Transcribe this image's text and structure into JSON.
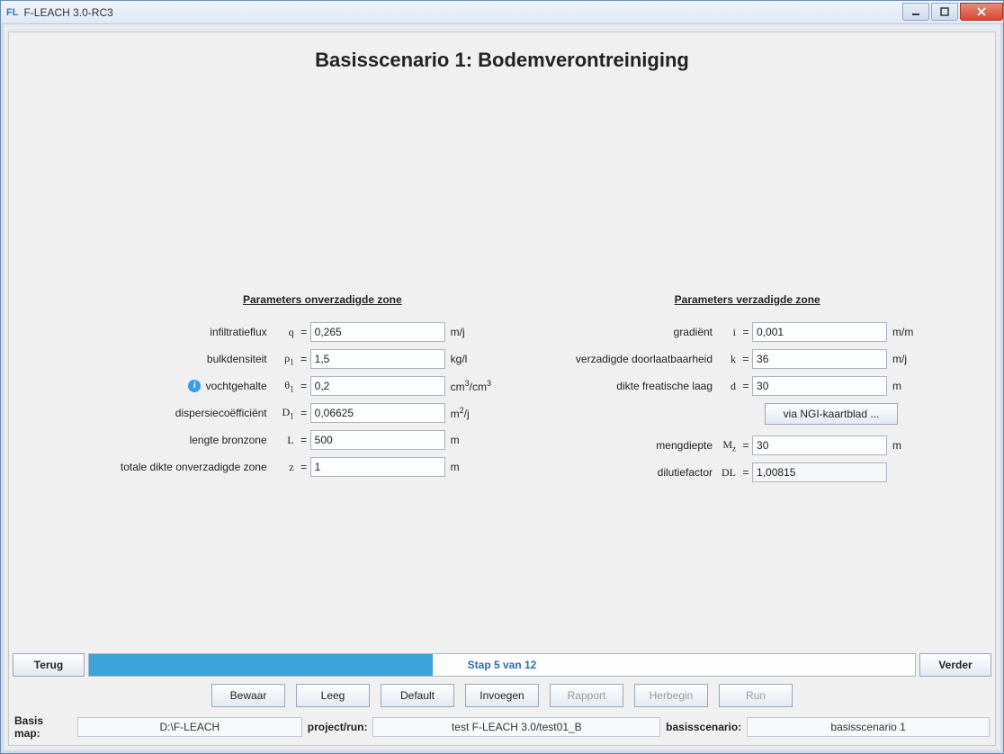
{
  "window": {
    "app_icon": "FL",
    "title": "F-LEACH 3.0-RC3"
  },
  "page_title": "Basisscenario 1: Bodemverontreiniging",
  "headers": {
    "left": "Parameters onverzadigde zone",
    "right": "Parameters verzadigde zone"
  },
  "left_params": {
    "infiltratieflux": {
      "label": "infiltratieflux",
      "sym": "q",
      "value": "0,265",
      "unit": "m/j"
    },
    "bulkdensiteit": {
      "label": "bulkdensiteit",
      "sym": "ρ",
      "sub": "1",
      "value": "1,5",
      "unit": "kg/l"
    },
    "vochtgehalte": {
      "label": "vochtgehalte",
      "sym": "θ",
      "sub": "1",
      "value": "0,2",
      "unit_html": "cm³/cm³"
    },
    "dispersie": {
      "label": "dispersiecoëfficiënt",
      "sym": "D",
      "sub": "1",
      "value": "0,06625",
      "unit_html": "m²/j"
    },
    "lengte_bronzone": {
      "label": "lengte bronzone",
      "sym": "L",
      "value": "500",
      "unit": "m"
    },
    "dikte_onverz": {
      "label": "totale dikte onverzadigde zone",
      "sym": "z",
      "value": "1",
      "unit": "m"
    }
  },
  "right_params": {
    "gradient": {
      "label": "gradiënt",
      "sym": "i",
      "value": "0,001",
      "unit": "m/m"
    },
    "doorlaat": {
      "label": "verzadigde doorlaatbaarheid",
      "sym": "k",
      "value": "36",
      "unit": "m/j"
    },
    "dikte_fre": {
      "label": "dikte freatische laag",
      "sym": "d",
      "value": "30",
      "unit": "m"
    },
    "mengdiepte": {
      "label": "mengdiepte",
      "sym": "M",
      "sub": "z",
      "value": "30",
      "unit": "m"
    },
    "dilutie": {
      "label": "dilutiefactor",
      "sym": "DL",
      "value": "1,00815"
    }
  },
  "ngi_button": "via NGI-kaartblad ...",
  "nav": {
    "terug": "Terug",
    "verder": "Verder",
    "progress_text": "Stap 5 van 12",
    "progress_current": 5,
    "progress_total": 12
  },
  "actions": {
    "bewaar": "Bewaar",
    "leeg": "Leeg",
    "default": "Default",
    "invoegen": "Invoegen",
    "rapport": "Rapport",
    "herbegin": "Herbegin",
    "run": "Run"
  },
  "status": {
    "basis_map_label": "Basis map:",
    "basis_map": "D:\\F-LEACH",
    "project_run_label": "project/run:",
    "project_run": "test F-LEACH 3.0/test01_B",
    "basisscenario_label": "basisscenario:",
    "basisscenario": "basisscenario 1"
  }
}
